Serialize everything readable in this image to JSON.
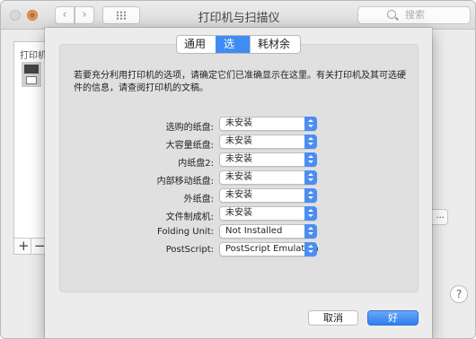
{
  "window": {
    "title": "打印机与扫描仪",
    "search_placeholder": "搜索",
    "nav_back": "‹",
    "nav_forward": "›"
  },
  "background": {
    "printer_list_header": "打印机",
    "add_label": "+",
    "remove_label": "−",
    "options_button_label": "...",
    "help_label": "?"
  },
  "sheet": {
    "tabs": [
      {
        "label": "通用",
        "active": false
      },
      {
        "label": "选项",
        "active": true
      },
      {
        "label": "耗材余量",
        "active": false
      }
    ],
    "description": "若要充分利用打印机的选项，请确定它们已准确显示在这里。有关打印机及其可选硬件的信息，请查阅打印机的文稿。",
    "options": [
      {
        "label": "选购的纸盘:",
        "value": "未安装"
      },
      {
        "label": "大容量纸盘:",
        "value": "未安装"
      },
      {
        "label": "内纸盘2:",
        "value": "未安装"
      },
      {
        "label": "内部移动纸盘:",
        "value": "未安装"
      },
      {
        "label": "外纸盘:",
        "value": "未安装"
      },
      {
        "label": "文件制成机:",
        "value": "未安装"
      },
      {
        "label": "Folding Unit:",
        "value": "Not Installed"
      },
      {
        "label": "PostScript:",
        "value": "PostScript Emulation"
      }
    ],
    "cancel_label": "取消",
    "ok_label": "好"
  },
  "colors": {
    "accent": "#3f8cf3",
    "window_bg": "#ececec",
    "panel_bg": "#e0e0e0"
  }
}
